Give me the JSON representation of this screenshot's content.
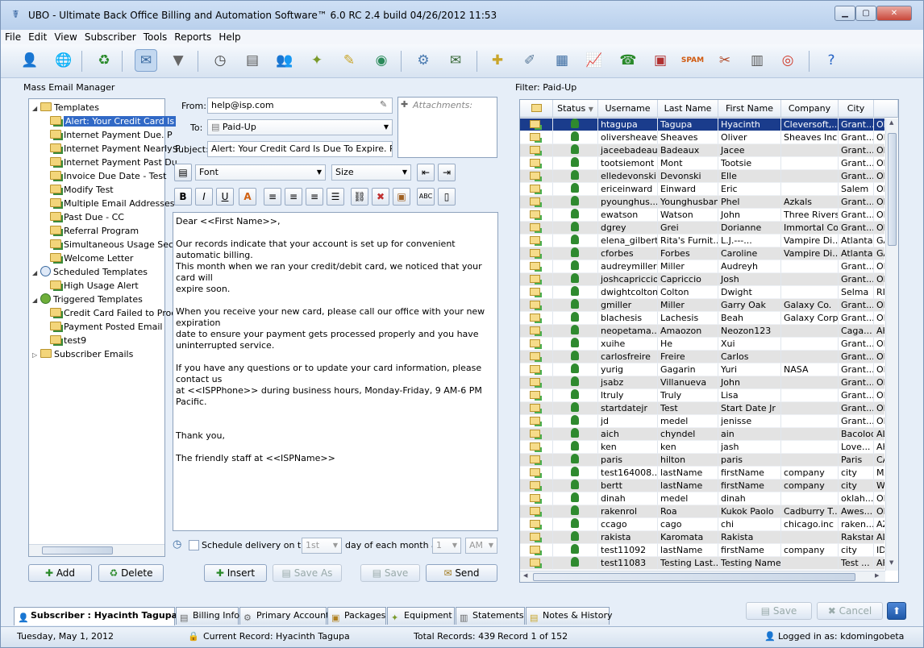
{
  "window": {
    "title": "UBO - Ultimate Back Office Billing and Automation Software™ 6.0 RC 2.4 build 04/26/2012 11:53"
  },
  "menu": [
    "File",
    "Edit",
    "View",
    "Subscriber",
    "Tools",
    "Reports",
    "Help"
  ],
  "toolbar_icons": [
    "add-subscriber-icon",
    "globe-icon",
    "recycle-icon",
    "mass-email-icon",
    "filter-icon",
    "clock-icon",
    "document-icon",
    "users-icon",
    "puzzle-icon",
    "notepad-icon",
    "network-icon",
    "settings-icon",
    "email-icon",
    "note-add-icon",
    "note-edit-icon",
    "report-icon",
    "chart-icon",
    "support-icon",
    "package-icon",
    "spam-icon",
    "tools-icon",
    "calculator-icon",
    "lifebuoy-icon",
    "help-icon"
  ],
  "left": {
    "title": "Mass Email Manager",
    "tree": [
      {
        "label": "Templates",
        "level": 0,
        "expanded": true,
        "icon": "folder"
      },
      {
        "label": "Alert: Your Credit Card Is",
        "level": 1,
        "selected": true,
        "icon": "email"
      },
      {
        "label": "Internet Payment Due.  P",
        "level": 1,
        "icon": "email"
      },
      {
        "label": "Internet Payment Nearly P",
        "level": 1,
        "icon": "email"
      },
      {
        "label": "Internet Payment Past Du",
        "level": 1,
        "icon": "email"
      },
      {
        "label": "Invoice Due Date - Test",
        "level": 1,
        "icon": "email"
      },
      {
        "label": "Modify Test",
        "level": 1,
        "icon": "email"
      },
      {
        "label": "Multiple Email Addresses",
        "level": 1,
        "icon": "email"
      },
      {
        "label": "Past Due - CC",
        "level": 1,
        "icon": "email"
      },
      {
        "label": "Referral Program",
        "level": 1,
        "icon": "email"
      },
      {
        "label": "Simultaneous Usage Secu",
        "level": 1,
        "icon": "email"
      },
      {
        "label": "Welcome Letter",
        "level": 1,
        "icon": "email"
      },
      {
        "label": "Scheduled Templates",
        "level": 0,
        "expanded": true,
        "icon": "clock"
      },
      {
        "label": "High Usage Alert",
        "level": 1,
        "icon": "email"
      },
      {
        "label": "Triggered Templates",
        "level": 0,
        "expanded": true,
        "icon": "gear"
      },
      {
        "label": "Credit Card Failed to Proc",
        "level": 1,
        "icon": "email"
      },
      {
        "label": "Payment Posted Email",
        "level": 1,
        "icon": "email"
      },
      {
        "label": "test9",
        "level": 1,
        "icon": "email"
      },
      {
        "label": "Subscriber Emails",
        "level": 0,
        "expanded": false,
        "icon": "folder"
      }
    ],
    "add_label": "Add",
    "delete_label": "Delete"
  },
  "editor": {
    "from_label": "From:",
    "from_value": "help@isp.com",
    "to_label": "To:",
    "to_value": "Paid-Up",
    "subject_label": "Subject:",
    "subject_value": "Alert: Your Credit Card Is Due To Expire.  Plea",
    "attachments_label": "Attachments:",
    "font_placeholder": "Font",
    "size_placeholder": "Size",
    "body": "Dear <<First Name>>,\n\nOur records indicate that your account is set up for convenient automatic billing.\nThis month when we ran your credit/debit card, we noticed that your card will\nexpire soon.\n\nWhen you receive your new card, please call our office with your new expiration\ndate to ensure your payment gets processed properly and you have\nuninterrupted service.\n\nIf you have any questions or to update your card information, please contact us\nat <<ISPPhone>> during business hours, Monday-Friday, 9 AM-6 PM Pacific.\n\n\nThank you,\n\nThe friendly staff at <<ISPName>>",
    "schedule_label": "Schedule delivery on the",
    "schedule_day": "1st",
    "schedule_mid": "day of each month at",
    "schedule_hour": "1",
    "schedule_ampm": "AM",
    "insert_label": "Insert",
    "saveas_label": "Save As",
    "save_label": "Save",
    "send_label": "Send"
  },
  "right": {
    "title": "Filter: Paid-Up",
    "columns": [
      "Status",
      "Username",
      "Last Name",
      "First Name",
      "Company",
      "City"
    ],
    "rows": [
      {
        "u": "htagupa",
        "l": "Tagupa",
        "f": "Hyacinth",
        "c": "Cleversoft,...",
        "city": "Grant...",
        "st": "OF",
        "sel": true
      },
      {
        "u": "oliversheaves",
        "l": "Sheaves",
        "f": "Oliver",
        "c": "Sheaves Inc.",
        "city": "Grant...",
        "st": "OF"
      },
      {
        "u": "jaceebadeaux",
        "l": "Badeaux",
        "f": "Jacee",
        "c": "",
        "city": "Grant...",
        "st": "OF"
      },
      {
        "u": "tootsiemont",
        "l": "Mont",
        "f": "Tootsie",
        "c": "",
        "city": "Grant...",
        "st": "OF"
      },
      {
        "u": "elledevonski",
        "l": "Devonski",
        "f": "Elle",
        "c": "",
        "city": "Grant...",
        "st": "OF"
      },
      {
        "u": "ericeinward",
        "l": "Einward",
        "f": "Eric",
        "c": "",
        "city": "Salem",
        "st": "OF"
      },
      {
        "u": "pyounghus...",
        "l": "Younghusband",
        "f": "Phel",
        "c": "Azkals",
        "city": "Grant...",
        "st": "OF"
      },
      {
        "u": "ewatson",
        "l": "Watson",
        "f": "John",
        "c": "Three Rivers",
        "city": "Grant...",
        "st": "OF"
      },
      {
        "u": "dgrey",
        "l": "Grei",
        "f": "Dorianne",
        "c": "Immortal Co.",
        "city": "Grant...",
        "st": "OF"
      },
      {
        "u": "elena_gilbert",
        "l": "Rita's Furnit...",
        "f": "L.J.---...",
        "c": "Vampire Di...",
        "city": "Atlanta",
        "st": "GA"
      },
      {
        "u": "cforbes",
        "l": "Forbes",
        "f": "Caroline",
        "c": "Vampire Di...",
        "city": "Atlanta",
        "st": "GA"
      },
      {
        "u": "audreymiller",
        "l": "Miller",
        "f": "Audreyh",
        "c": "",
        "city": "Grant...",
        "st": "OF"
      },
      {
        "u": "joshcapriccio",
        "l": "Capriccio",
        "f": "Josh",
        "c": "",
        "city": "Grant...",
        "st": "OF"
      },
      {
        "u": "dwightcolton",
        "l": "Colton",
        "f": "Dwight",
        "c": "",
        "city": "Selma",
        "st": "RI"
      },
      {
        "u": "gmiller",
        "l": "Miller",
        "f": "Garry Oak",
        "c": "Galaxy Co.",
        "city": "Grant...",
        "st": "OF"
      },
      {
        "u": "blachesis",
        "l": "Lachesis",
        "f": "Beah",
        "c": "Galaxy Corp.",
        "city": "Grant...",
        "st": "OF"
      },
      {
        "u": "neopetama...",
        "l": "Amaozon",
        "f": "Neozon123",
        "c": "",
        "city": "Caga...",
        "st": "AK"
      },
      {
        "u": "xuihe",
        "l": "He",
        "f": "Xui",
        "c": "",
        "city": "Grant...",
        "st": "OF"
      },
      {
        "u": "carlosfreire",
        "l": "Freire",
        "f": "Carlos",
        "c": "",
        "city": "Grant...",
        "st": "OF"
      },
      {
        "u": "yurig",
        "l": "Gagarin",
        "f": "Yuri",
        "c": "NASA",
        "city": "Grant...",
        "st": "OF"
      },
      {
        "u": "jsabz",
        "l": "Villanueva",
        "f": "John",
        "c": "",
        "city": "Grant...",
        "st": "OF"
      },
      {
        "u": "ltruly",
        "l": "Truly",
        "f": "Lisa",
        "c": "",
        "city": "Grant...",
        "st": "OF"
      },
      {
        "u": "startdatejr",
        "l": "Test",
        "f": "Start Date Jr",
        "c": "",
        "city": "Grant...",
        "st": "OF"
      },
      {
        "u": "jd",
        "l": "medel",
        "f": "jenisse",
        "c": "",
        "city": "Grant...",
        "st": "OF"
      },
      {
        "u": "aich",
        "l": "chyndel",
        "f": "ain",
        "c": "",
        "city": "Bacolod",
        "st": "AL"
      },
      {
        "u": "ken",
        "l": "ken",
        "f": "jash",
        "c": "",
        "city": "Love...",
        "st": "AK"
      },
      {
        "u": "paris",
        "l": "hilton",
        "f": "paris",
        "c": "",
        "city": "Paris",
        "st": "CA"
      },
      {
        "u": "test164008...",
        "l": "lastName",
        "f": "firstName",
        "c": "company",
        "city": "city",
        "st": "MA"
      },
      {
        "u": "bertt",
        "l": "lastName",
        "f": "firstName",
        "c": "company",
        "city": "city",
        "st": "W"
      },
      {
        "u": "dinah",
        "l": "medel",
        "f": "dinah",
        "c": "",
        "city": "oklah...",
        "st": "OK"
      },
      {
        "u": "rakenrol",
        "l": "Roa",
        "f": "Kukok  Paolo",
        "c": "Cadburry T...",
        "city": "Awes...",
        "st": "OF"
      },
      {
        "u": "ccago",
        "l": "cago",
        "f": "chi",
        "c": "chicago.inc",
        "city": "raken...",
        "st": "AZ"
      },
      {
        "u": "rakista",
        "l": "Karomata",
        "f": "Rakista",
        "c": "",
        "city": "Rakstar",
        "st": "AL"
      },
      {
        "u": "test11092",
        "l": "lastName",
        "f": "firstName",
        "c": "company",
        "city": "city",
        "st": "ID"
      },
      {
        "u": "test11083",
        "l": "Testing Last...",
        "f": "Testing Name",
        "c": "",
        "city": "Test ...",
        "st": "AF"
      }
    ]
  },
  "tabs": [
    "Subscriber : Hyacinth Tagupa",
    "Billing Info",
    "Primary Account",
    "Packages",
    "Equipment",
    "Statements",
    "Notes & History"
  ],
  "bottom_buttons": {
    "save": "Save",
    "cancel": "Cancel"
  },
  "status": {
    "date": "Tuesday, May 1, 2012",
    "current_record": "Current Record: Hyacinth Tagupa",
    "total": "Total Records: 439",
    "record": "Record 1 of 152",
    "logged": "Logged in as: kdomingobeta"
  }
}
